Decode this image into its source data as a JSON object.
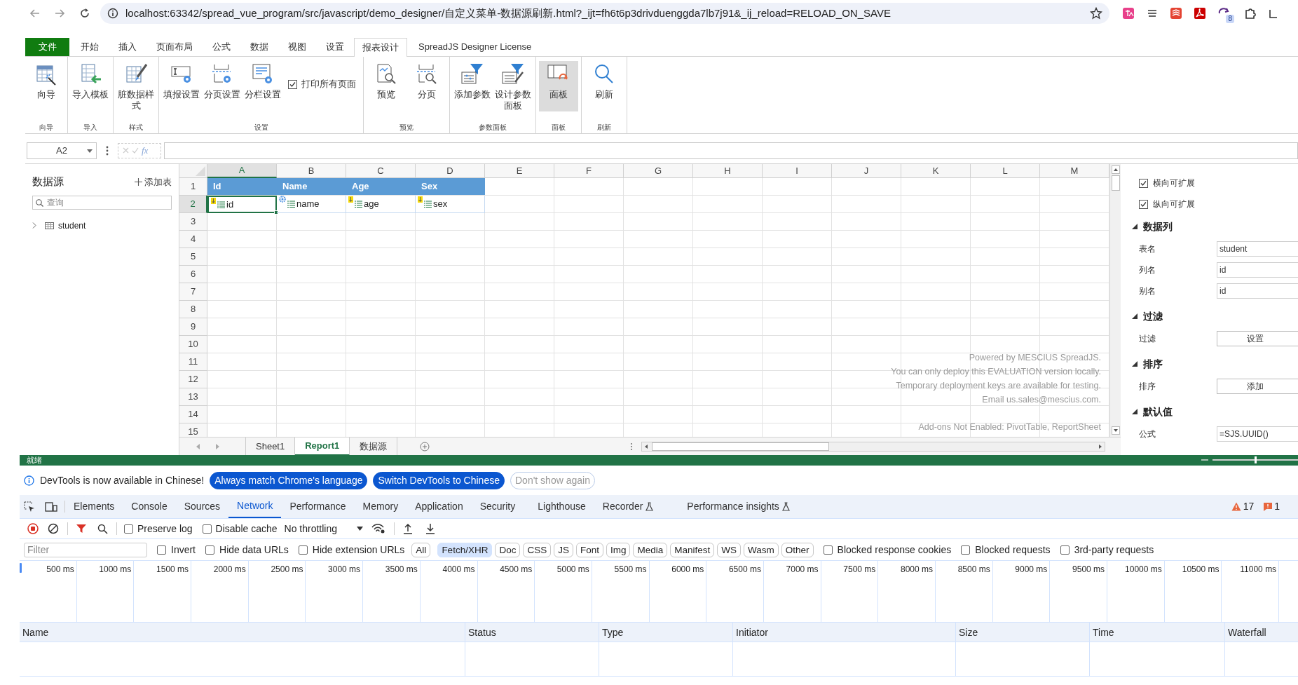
{
  "browser": {
    "url": "localhost:63342/spread_vue_program/src/javascript/demo_designer/自定义菜单-数据源刷新.html?_ijt=fh6t6p3drivduenggda7lb7j91&_ij_reload=RELOAD_ON_SAVE",
    "extension_badge": "8"
  },
  "ribbon": {
    "tabs": [
      {
        "label": "文件",
        "kind": "file",
        "selected": false
      },
      {
        "label": "开始",
        "kind": "tab",
        "selected": false
      },
      {
        "label": "插入",
        "kind": "tab",
        "selected": false
      },
      {
        "label": "页面布局",
        "kind": "tab",
        "selected": false
      },
      {
        "label": "公式",
        "kind": "tab",
        "selected": false
      },
      {
        "label": "数据",
        "kind": "tab",
        "selected": false
      },
      {
        "label": "视图",
        "kind": "tab",
        "selected": false
      },
      {
        "label": "设置",
        "kind": "tab",
        "selected": false
      },
      {
        "label": "报表设计",
        "kind": "tab",
        "selected": true
      },
      {
        "label": "SpreadJS Designer License",
        "kind": "tab",
        "selected": false
      }
    ],
    "groups": [
      {
        "label": "向导",
        "items": [
          {
            "kind": "button",
            "label": "向导",
            "selected": false
          }
        ]
      },
      {
        "label": "导入",
        "items": [
          {
            "kind": "button",
            "label": "导入模板",
            "selected": false
          }
        ]
      },
      {
        "label": "样式",
        "items": [
          {
            "kind": "button",
            "label": "脏数据样式",
            "selected": false
          }
        ]
      },
      {
        "label": "设置",
        "items": [
          {
            "kind": "button",
            "label": "填报设置",
            "selected": false
          },
          {
            "kind": "button",
            "label": "分页设置",
            "selected": false
          },
          {
            "kind": "button",
            "label": "分栏设置",
            "selected": false
          },
          {
            "kind": "checkbox",
            "label": "打印所有页面",
            "checked": true
          }
        ]
      },
      {
        "label": "预览",
        "items": [
          {
            "kind": "button",
            "label": "预览",
            "selected": false
          },
          {
            "kind": "button",
            "label": "分页",
            "selected": false
          }
        ]
      },
      {
        "label": "参数面板",
        "items": [
          {
            "kind": "button",
            "label": "添加参数",
            "selected": false
          },
          {
            "kind": "button",
            "label": "设计参数面板",
            "selected": false
          }
        ]
      },
      {
        "label": "面板",
        "items": [
          {
            "kind": "button",
            "label": "面板",
            "selected": true
          }
        ]
      },
      {
        "label": "刷新",
        "items": [
          {
            "kind": "button",
            "label": "刷新",
            "selected": false
          }
        ]
      }
    ]
  },
  "formula_bar": {
    "name_box": "A2",
    "function_label": "fx"
  },
  "data_source_panel": {
    "title": "数据源",
    "add_label": "添加表",
    "search_placeholder": "查询",
    "tree": [
      {
        "label": "student",
        "expanded": false
      }
    ]
  },
  "sheet": {
    "columns": [
      {
        "label": "A",
        "selected": true
      },
      {
        "label": "B",
        "selected": false
      },
      {
        "label": "C",
        "selected": false
      },
      {
        "label": "D",
        "selected": false
      },
      {
        "label": "E",
        "selected": false
      },
      {
        "label": "F",
        "selected": false
      },
      {
        "label": "G",
        "selected": false
      },
      {
        "label": "H",
        "selected": false
      },
      {
        "label": "I",
        "selected": false
      },
      {
        "label": "J",
        "selected": false
      },
      {
        "label": "K",
        "selected": false
      },
      {
        "label": "L",
        "selected": false
      },
      {
        "label": "M",
        "selected": false
      }
    ],
    "rows": [
      {
        "label": "1",
        "selected": false,
        "cells": [
          {
            "text": "Id",
            "kind": "header",
            "selected": false
          },
          {
            "text": "Name",
            "kind": "header",
            "selected": false
          },
          {
            "text": "Age",
            "kind": "header",
            "selected": false
          },
          {
            "text": "Sex",
            "kind": "header",
            "selected": false
          }
        ]
      },
      {
        "label": "2",
        "selected": true,
        "cells": [
          {
            "text": "id",
            "kind": "expand",
            "selected": true
          },
          {
            "text": "name",
            "kind": "setting",
            "selected": false
          },
          {
            "text": "age",
            "kind": "expand",
            "selected": false
          },
          {
            "text": "sex",
            "kind": "expand",
            "selected": false
          }
        ]
      },
      {
        "label": "3",
        "selected": false
      },
      {
        "label": "4",
        "selected": false
      },
      {
        "label": "5",
        "selected": false
      },
      {
        "label": "6",
        "selected": false
      },
      {
        "label": "7",
        "selected": false
      },
      {
        "label": "8",
        "selected": false
      },
      {
        "label": "9",
        "selected": false
      },
      {
        "label": "10",
        "selected": false
      },
      {
        "label": "11",
        "selected": false
      },
      {
        "label": "12",
        "selected": false
      },
      {
        "label": "13",
        "selected": false
      },
      {
        "label": "14",
        "selected": false
      },
      {
        "label": "15",
        "selected": false
      }
    ],
    "evaluation_notice": [
      "Powered by MESCIUS SpreadJS.",
      "You can only deploy this EVALUATION version locally.",
      "Temporary deployment keys are available for testing.",
      "Email us.sales@mescius.com."
    ],
    "addons_notice": "Add-ons Not Enabled: PivotTable, ReportSheet"
  },
  "sheet_tabs": [
    {
      "label": "Sheet1",
      "selected": false
    },
    {
      "label": "Report1",
      "selected": true
    },
    {
      "label": "数据源",
      "selected": false
    }
  ],
  "properties_panel": {
    "options": [
      {
        "label": "横向可扩展",
        "checked": true
      },
      {
        "label": "纵向可扩展",
        "checked": true
      }
    ],
    "sections": [
      {
        "title": "数据列",
        "expanded": true,
        "rows": [
          {
            "label": "表名",
            "kind": "input",
            "value": "student"
          },
          {
            "label": "列名",
            "kind": "input",
            "value": "id"
          },
          {
            "label": "别名",
            "kind": "input",
            "value": "id"
          }
        ]
      },
      {
        "title": "过滤",
        "expanded": true,
        "rows": [
          {
            "label": "过滤",
            "kind": "button",
            "value": "设置"
          }
        ]
      },
      {
        "title": "排序",
        "expanded": true,
        "rows": [
          {
            "label": "排序",
            "kind": "button",
            "value": "添加"
          }
        ]
      },
      {
        "title": "默认值",
        "expanded": true,
        "rows": [
          {
            "label": "公式",
            "kind": "input",
            "value": "=SJS.UUID()"
          }
        ]
      }
    ]
  },
  "status_bar": {
    "text": "就绪",
    "zoom_slider": {
      "level": 0.5
    }
  },
  "devtools": {
    "banner": {
      "message": "DevTools is now available in Chinese!",
      "buttons": [
        {
          "label": "Always match Chrome's language",
          "kind": "primary"
        },
        {
          "label": "Switch DevTools to Chinese",
          "kind": "primary"
        },
        {
          "label": "Don't show again",
          "kind": "secondary"
        }
      ]
    },
    "tabs": [
      {
        "label": "Elements",
        "selected": false,
        "experimental": false
      },
      {
        "label": "Console",
        "selected": false,
        "experimental": false
      },
      {
        "label": "Sources",
        "selected": false,
        "experimental": false
      },
      {
        "label": "Network",
        "selected": true,
        "experimental": false
      },
      {
        "label": "Performance",
        "selected": false,
        "experimental": false
      },
      {
        "label": "Memory",
        "selected": false,
        "experimental": false
      },
      {
        "label": "Application",
        "selected": false,
        "experimental": false
      },
      {
        "label": "Security",
        "selected": false,
        "experimental": false
      },
      {
        "label": "Lighthouse",
        "selected": false,
        "experimental": false
      },
      {
        "label": "Recorder",
        "selected": false,
        "experimental": true
      },
      {
        "label": "Performance insights",
        "selected": false,
        "experimental": true
      }
    ],
    "warnings": "17",
    "issues": "1",
    "toolbar": {
      "options": [
        {
          "label": "Preserve log",
          "checked": false
        },
        {
          "label": "Disable cache",
          "checked": false
        }
      ],
      "throttling": "No throttling"
    },
    "filter": {
      "placeholder": "Filter",
      "options": [
        {
          "label": "Invert",
          "checked": false
        },
        {
          "label": "Hide data URLs",
          "checked": false
        },
        {
          "label": "Hide extension URLs",
          "checked": false
        }
      ],
      "types": [
        {
          "label": "All",
          "selected": false
        },
        {
          "label": "Fetch/XHR",
          "selected": true
        },
        {
          "label": "Doc",
          "selected": false
        },
        {
          "label": "CSS",
          "selected": false
        },
        {
          "label": "JS",
          "selected": false
        },
        {
          "label": "Font",
          "selected": false
        },
        {
          "label": "Img",
          "selected": false
        },
        {
          "label": "Media",
          "selected": false
        },
        {
          "label": "Manifest",
          "selected": false
        },
        {
          "label": "WS",
          "selected": false
        },
        {
          "label": "Wasm",
          "selected": false
        },
        {
          "label": "Other",
          "selected": false
        }
      ],
      "more_options": [
        {
          "label": "Blocked response cookies",
          "checked": false
        },
        {
          "label": "Blocked requests",
          "checked": false
        },
        {
          "label": "3rd-party requests",
          "checked": false
        }
      ]
    },
    "timeline_ticks": [
      "500 ms",
      "1000 ms",
      "1500 ms",
      "2000 ms",
      "2500 ms",
      "3000 ms",
      "3500 ms",
      "4000 ms",
      "4500 ms",
      "5000 ms",
      "5500 ms",
      "6000 ms",
      "6500 ms",
      "7000 ms",
      "7500 ms",
      "8000 ms",
      "8500 ms",
      "9000 ms",
      "9500 ms",
      "10000 ms",
      "10500 ms",
      "11000 ms"
    ],
    "columns": [
      "Name",
      "Status",
      "Type",
      "Initiator",
      "Size",
      "Time",
      "Waterfall"
    ]
  }
}
